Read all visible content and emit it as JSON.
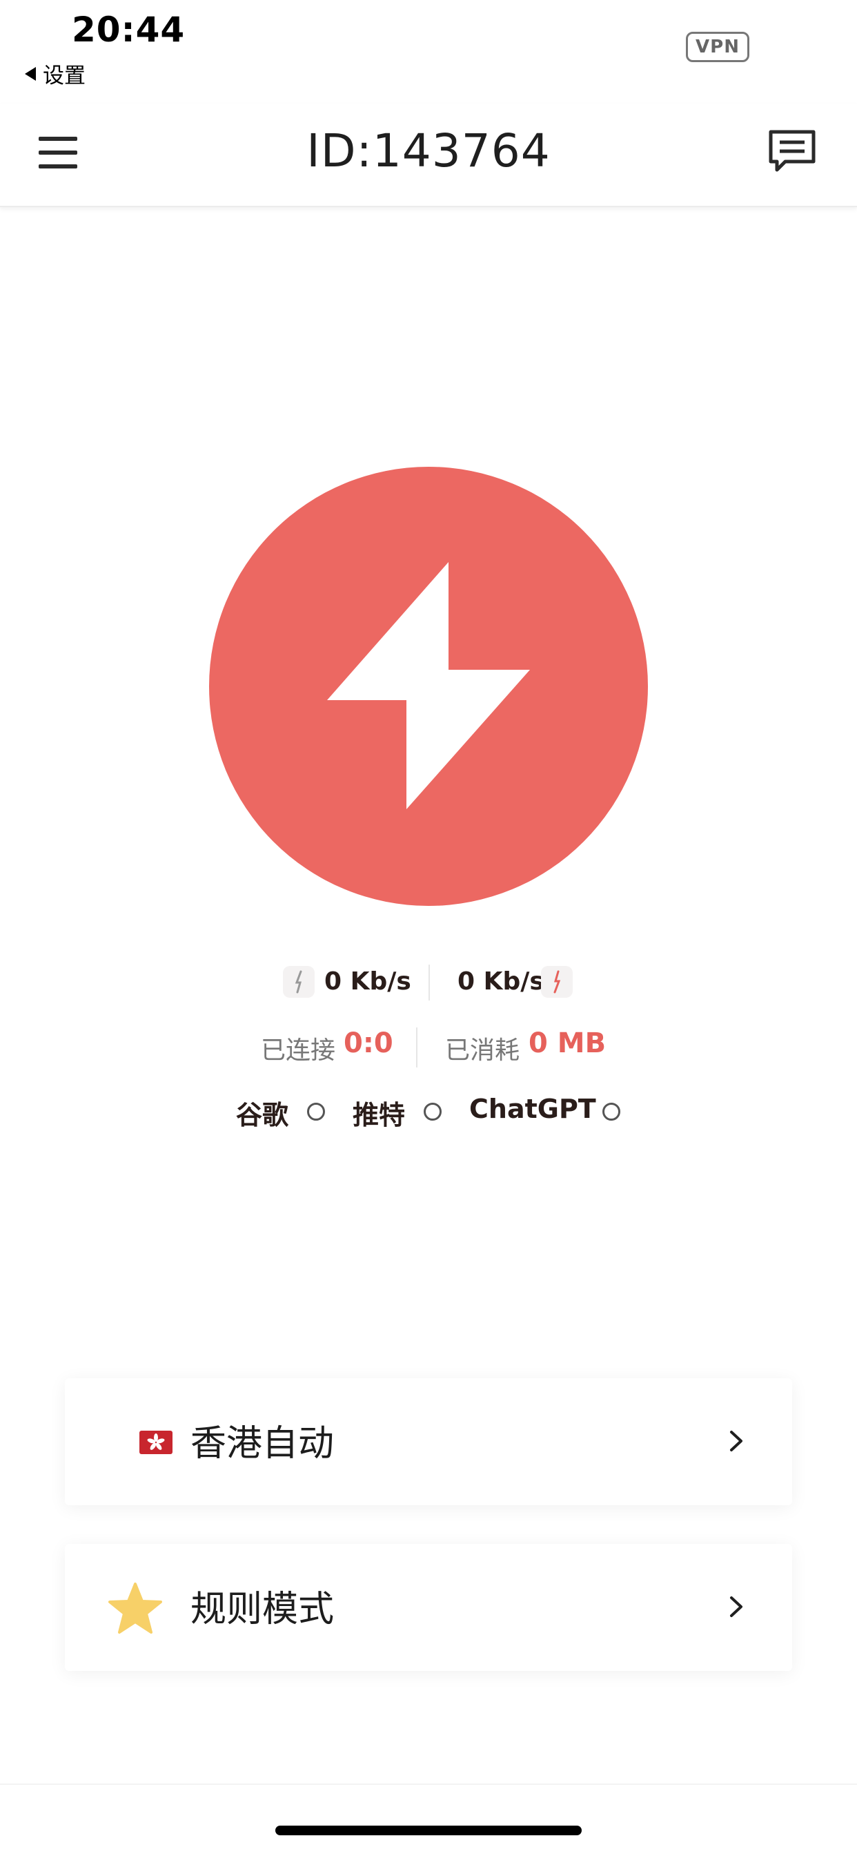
{
  "status_bar": {
    "time": "20:44",
    "back_label": "设置",
    "vpn_badge": "VPN"
  },
  "nav": {
    "title": "ID:143764"
  },
  "stats": {
    "download_speed": "0 Kb/s",
    "upload_speed": "0 Kb/s",
    "connected_label": "已连接",
    "connected_value": "0:0",
    "consumed_label": "已消耗",
    "consumed_value": "0 MB"
  },
  "tests": [
    {
      "label": "谷歌"
    },
    {
      "label": "推特"
    },
    {
      "label": "ChatGPT"
    }
  ],
  "cards": {
    "server": {
      "label": "香港自动",
      "flag_icon": "hong-kong-flag-icon"
    },
    "mode": {
      "label": "规则模式",
      "icon": "star-icon"
    }
  },
  "colors": {
    "accent": "#ec6862",
    "value_red": "#e6615b",
    "star": "#f7d068"
  }
}
